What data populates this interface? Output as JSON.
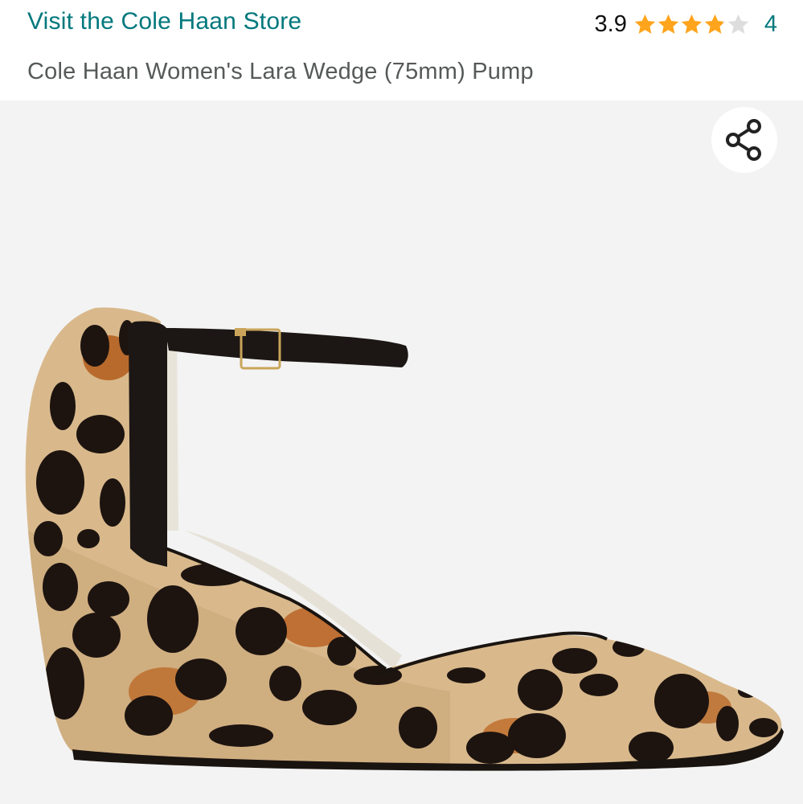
{
  "header": {
    "store_link": "Visit the Cole Haan Store",
    "rating_value": "3.9",
    "rating_stars": 3.9,
    "rating_max": 5,
    "review_count": "4",
    "product_title": "Cole Haan Women's Lara Wedge (75mm) Pump"
  },
  "image": {
    "share_icon": "share-icon",
    "product_image": "leopard-print-wedge-pump"
  },
  "colors": {
    "link": "#00787d",
    "star_filled": "#ffa41c",
    "star_empty": "#dddddd",
    "title_text": "#565959",
    "image_bg": "#f3f3f3"
  }
}
